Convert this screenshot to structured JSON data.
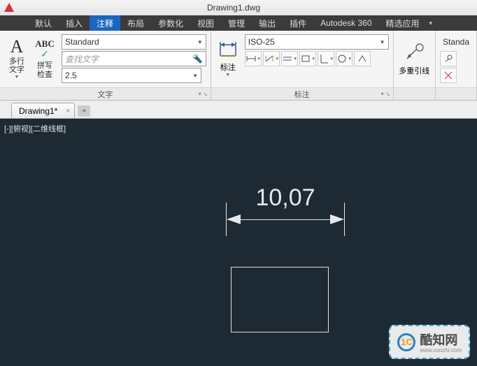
{
  "titlebar": {
    "filename": "Drawing1.dwg"
  },
  "menubar": {
    "items": [
      "默认",
      "插入",
      "注释",
      "布局",
      "参数化",
      "视图",
      "管理",
      "输出",
      "插件",
      "Autodesk 360",
      "精选应用"
    ],
    "active_index": 2
  },
  "ribbon": {
    "text_panel": {
      "title": "文字",
      "multiline_label": "多行\n文字",
      "spell_label": "拼写\n检查",
      "abc_label": "ABC",
      "style_combo": "Standard",
      "find_placeholder": "查找文字",
      "height_combo": "2.5"
    },
    "dim_panel": {
      "title": "标注",
      "btn_label": "标注",
      "style_combo": "ISO-25"
    },
    "leader_panel": {
      "btn_label": "多重引线"
    },
    "extra_panel": {
      "style_combo": "Standa"
    }
  },
  "doctabs": {
    "active": "Drawing1*"
  },
  "canvas": {
    "viewport_label": "[-][俯视][二维线框]",
    "dimension_text": "10,07"
  },
  "watermark": {
    "brand_cn": "酷知网",
    "brand_url": "www.coozhi.com",
    "logo_text": "1C"
  }
}
